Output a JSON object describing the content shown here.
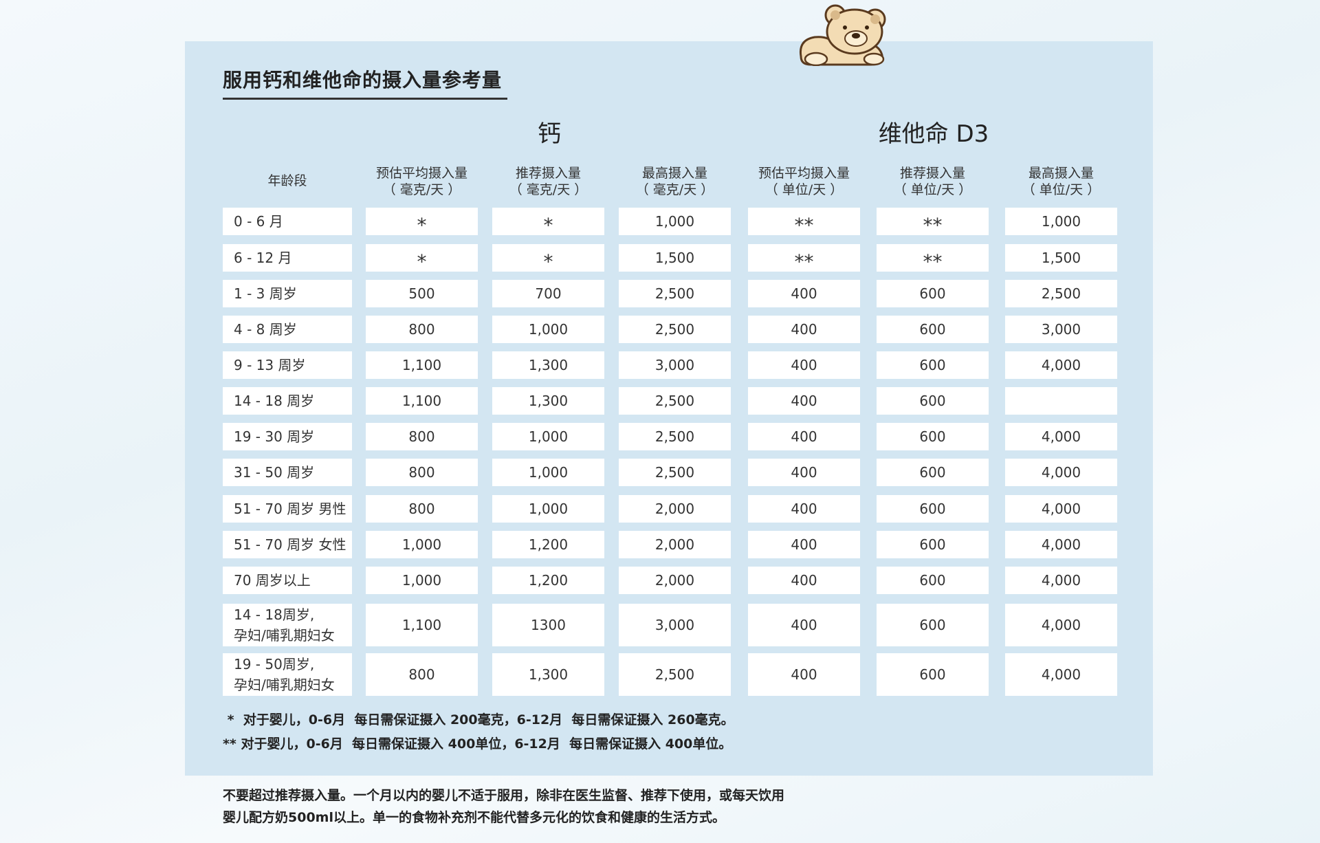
{
  "title": "服用钙和维他命的摄入量参考量",
  "groups": {
    "calcium": "钙",
    "vitamin_d3": "维他命 D3"
  },
  "columns": [
    {
      "line1": "年龄段",
      "line2": ""
    },
    {
      "line1": "预估平均摄入量",
      "line2": "（ 毫克/天 ）"
    },
    {
      "line1": "推荐摄入量",
      "line2": "（ 毫克/天 ）"
    },
    {
      "line1": "最高摄入量",
      "line2": "（ 毫克/天 ）"
    },
    {
      "line1": "预估平均摄入量",
      "line2": "（ 单位/天 ）"
    },
    {
      "line1": "推荐摄入量",
      "line2": "（ 单位/天 ）"
    },
    {
      "line1": "最高摄入量",
      "line2": "（ 单位/天 ）"
    }
  ],
  "rows": [
    {
      "age": "0 - 6 月",
      "cells": [
        "*",
        "*",
        "1,000",
        "**",
        "**",
        "1,000"
      ]
    },
    {
      "age": "6 - 12 月",
      "cells": [
        "*",
        "*",
        "1,500",
        "**",
        "**",
        "1,500"
      ]
    },
    {
      "age": "1 - 3 周岁",
      "cells": [
        "500",
        "700",
        "2,500",
        "400",
        "600",
        "2,500"
      ]
    },
    {
      "age": "4 - 8 周岁",
      "cells": [
        "800",
        "1,000",
        "2,500",
        "400",
        "600",
        "3,000"
      ]
    },
    {
      "age": "9 - 13 周岁",
      "cells": [
        "1,100",
        "1,300",
        "3,000",
        "400",
        "600",
        "4,000"
      ]
    },
    {
      "age": "14 - 18 周岁",
      "cells": [
        "1,100",
        "1,300",
        "2,500",
        "400",
        "600",
        ""
      ]
    },
    {
      "age": "19 - 30 周岁",
      "cells": [
        "800",
        "1,000",
        "2,500",
        "400",
        "600",
        "4,000"
      ]
    },
    {
      "age": "31 - 50 周岁",
      "cells": [
        "800",
        "1,000",
        "2,500",
        "400",
        "600",
        "4,000"
      ]
    },
    {
      "age": "51 - 70 周岁 男性",
      "cells": [
        "800",
        "1,000",
        "2,000",
        "400",
        "600",
        "4,000"
      ]
    },
    {
      "age": "51 - 70 周岁 女性",
      "cells": [
        "1,000",
        "1,200",
        "2,000",
        "400",
        "600",
        "4,000"
      ]
    },
    {
      "age": "70 周岁以上",
      "cells": [
        "1,000",
        "1,200",
        "2,000",
        "400",
        "600",
        "4,000"
      ]
    },
    {
      "age": "14 - 18周岁,\n孕妇/哺乳期妇女",
      "cells": [
        "1,100",
        "1300",
        "3,000",
        "400",
        "600",
        "4,000"
      ]
    },
    {
      "age": "19 - 50周岁,\n孕妇/哺乳期妇女",
      "cells": [
        "800",
        "1,300",
        "2,500",
        "400",
        "600",
        "4,000"
      ]
    }
  ],
  "footnotes": [
    " *  对于婴儿，0-6月  每日需保证摄入 200毫克，6-12月  每日需保证摄入 260毫克。",
    "** 对于婴儿，0-6月  每日需保证摄入 400单位，6-12月  每日需保证摄入 400单位。"
  ],
  "disclaimer": [
    "不要超过推荐摄入量。一个月以内的婴儿不适于服用，除非在医生监督、推荐下使用，或每天饮用",
    "婴儿配方奶500ml以上。单一的食物补充剂不能代替多元化的饮食和健康的生活方式。"
  ],
  "icons": {
    "mascot": "teddy-bear-icon"
  },
  "colors": {
    "panel": "#d3e6f2",
    "cell": "#ffffff",
    "text": "#222222",
    "bear_fill": "#f3dcb4",
    "bear_outline": "#5a3a1e"
  }
}
